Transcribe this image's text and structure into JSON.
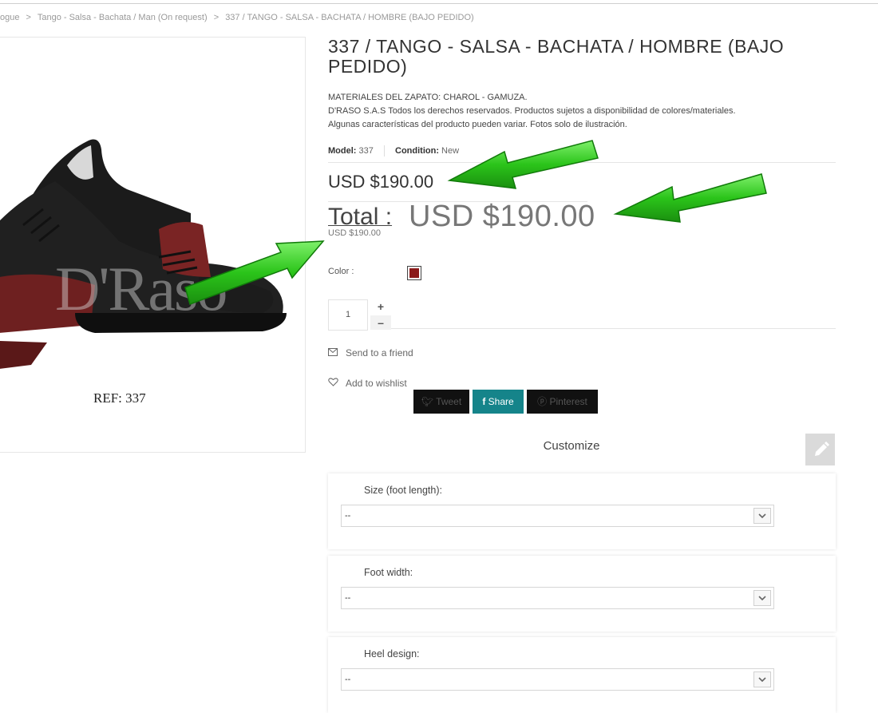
{
  "breadcrumb": {
    "items": [
      "ogue",
      "Tango - Salsa - Bachata / Man (On request)",
      "337 / TANGO - SALSA - BACHATA / HOMBRE (BAJO PEDIDO)"
    ],
    "separator": ">"
  },
  "product": {
    "title": "337 / TANGO - SALSA - BACHATA / HOMBRE (BAJO PEDIDO)",
    "description_line1": "MATERIALES DEL ZAPATO: CHAROL - GAMUZA.",
    "description_line2": "D'RASO S.A.S Todos los derechos reservados. Productos sujetos a disponibilidad de colores/materiales.",
    "description_line3": "Algunas características del producto pueden variar. Fotos solo de ilustración.",
    "model_label": "Model:",
    "model_value": "337",
    "condition_label": "Condition:",
    "condition_value": "New",
    "price": "USD $190.00",
    "total_label": "Total :",
    "total_value": "USD $190.00",
    "small_price": "USD $190.00",
    "image_ref": "REF: 337",
    "watermark": "D'Raso",
    "color_label": "Color :",
    "swatch_color": "#8b1a1a",
    "quantity": "1",
    "qty_plus": "+",
    "qty_minus": "–"
  },
  "actions": {
    "send_to_friend": "Send to a friend",
    "add_to_wishlist": "Add to wishlist",
    "tweet": "Tweet",
    "share": "Share",
    "pinterest": "Pinterest"
  },
  "customize": {
    "title": "Customize",
    "fields": [
      {
        "label": "Size (foot length):",
        "value": "--"
      },
      {
        "label": "Foot width:",
        "value": "--"
      },
      {
        "label": "Heel design:",
        "value": "--"
      }
    ]
  },
  "icons": {
    "mail": "envelope-icon",
    "heart": "heart-icon",
    "twitter": "twitter-icon",
    "facebook": "facebook-icon",
    "pinterest": "pinterest-icon",
    "pencil": "pencil-icon",
    "chevron": "chevron-down-icon"
  },
  "colors": {
    "share_bg": "#15848a",
    "arrow_green": "#2bc41a"
  }
}
